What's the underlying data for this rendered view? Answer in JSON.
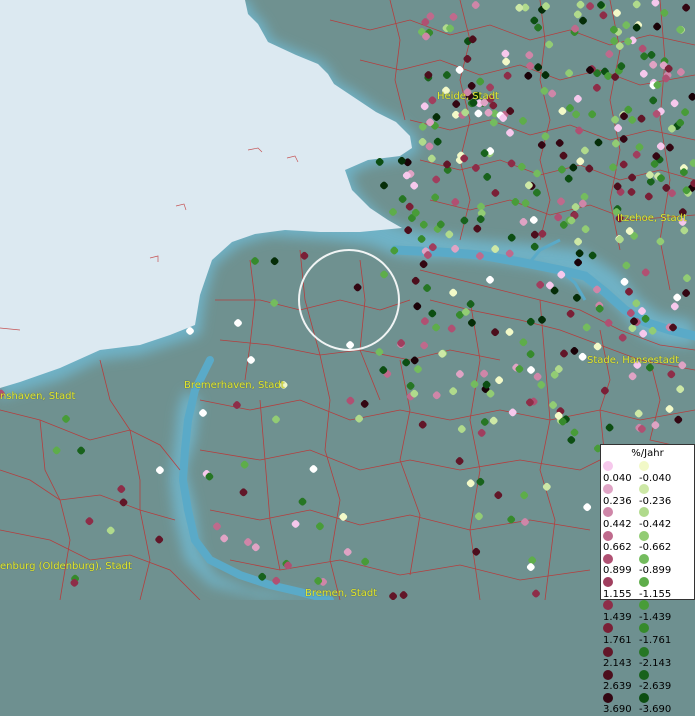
{
  "map": {
    "colors": {
      "sea": "#dce9f1",
      "sea_edge": "#6fb6cc",
      "land": "#6f9190",
      "river": "#5aaac8",
      "border": "#c03030",
      "selection_ring": "#ffffff"
    },
    "city_labels": [
      {
        "id": "heide",
        "name": "Heide, Stadt"
      },
      {
        "id": "itzehoe",
        "name": "Itzehoe, Stadt"
      },
      {
        "id": "bremerhaven",
        "name": "Bremerhaven, Stadt"
      },
      {
        "id": "wilhelmshaven",
        "name": "nshaven, Stadt"
      },
      {
        "id": "stade",
        "name": "Stade, Hansestadt"
      },
      {
        "id": "oldenburg",
        "name": "enburg (Oldenburg), Stadt"
      },
      {
        "id": "bremen",
        "name": "Bremen, Stadt"
      }
    ]
  },
  "legend": {
    "title": "%/Jahr",
    "positive_colors": [
      "#f6c8ec",
      "#dfa3c4",
      "#cf86a8",
      "#bf6a8c",
      "#b05072",
      "#a03e5e",
      "#8e2d48",
      "#7a1f36",
      "#621628",
      "#4c0e1c",
      "#330612",
      "#1a0208"
    ],
    "negative_colors": [
      "#f2f9c8",
      "#cde8a6",
      "#b0da8c",
      "#92cc74",
      "#74bc5e",
      "#5ead4a",
      "#489c38",
      "#368a2c",
      "#267624",
      "#18621c",
      "#0c4e12",
      "#052d08"
    ],
    "positive_values": [
      "0.040",
      "0.236",
      "0.442",
      "0.662",
      "0.899",
      "1.155",
      "1.439",
      "1.761",
      "2.143",
      "2.639",
      "3.690"
    ],
    "negative_values": [
      "-0.040",
      "-0.236",
      "-0.442",
      "-0.662",
      "-0.899",
      "-1.155",
      "-1.439",
      "-1.761",
      "-2.143",
      "-2.639",
      "-3.690"
    ]
  }
}
